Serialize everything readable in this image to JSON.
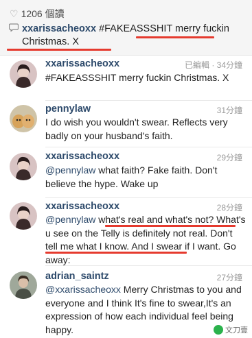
{
  "post": {
    "views": "1206 個讀",
    "caption_user": "xxarissacheoxx",
    "caption_text": "#FAKEASSSHIT merry fuckin Christmas. X"
  },
  "comments": [
    {
      "user": "xxarissacheoxx",
      "time": "已編輯 · 34分鐘",
      "text": "#FAKEASSSHIT merry fuckin Christmas. X"
    },
    {
      "user": "pennylaw",
      "time": "31分鐘",
      "text": "I do wish you wouldn't swear. Reflects very badly on your husband's faith."
    },
    {
      "user": "xxarissacheoxx",
      "time": "29分鐘",
      "mention": "@pennylaw",
      "text": " what faith? Fake faith. Don't believe the hype. Wake up"
    },
    {
      "user": "xxarissacheoxx",
      "time": "28分鐘",
      "mention": "@pennylaw",
      "text": " what's real and what's not? What's u see on the Telly is definitely not real. Don't tell me what I know. And I swear if I want. Go away:"
    },
    {
      "user": "adrian_saintz",
      "time": "27分鐘",
      "mention": "@xxarissacheoxx",
      "text": " Merry Christmas to you and everyone and I think It's fine to swear,It's an expression of how each individual feel being happy."
    }
  ],
  "watermark": {
    "label": "文刀壹"
  },
  "colors": {
    "username": "#2d4a6b",
    "highlight": "#e53a2e"
  }
}
